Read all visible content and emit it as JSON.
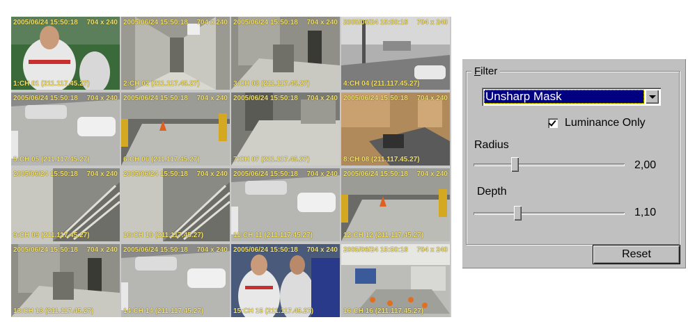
{
  "grid": {
    "tiles": [
      {
        "timestamp": "2005/06/24 15:50:18",
        "resolution": "704 x 240",
        "channel": "1:CH 01 (211.117.45.27)",
        "scene": "soccer-player"
      },
      {
        "timestamp": "2005/06/24 15:50:18",
        "resolution": "704 x 240",
        "channel": "2:CH 02 (211.117.45.27)",
        "scene": "corridor"
      },
      {
        "timestamp": "2005/06/24 15:50:18",
        "resolution": "704 x 240",
        "channel": "3:CH 03 (211.117.45.27)",
        "scene": "lobby"
      },
      {
        "timestamp": "2005/06/24 15:50:18",
        "resolution": "704 x 240",
        "channel": "4:CH 04 (211.117.45.27)",
        "scene": "street"
      },
      {
        "timestamp": "2005/06/24 15:50:18",
        "resolution": "704 x 240",
        "channel": "5:CH 05 (211.117.45.27)",
        "scene": "parking"
      },
      {
        "timestamp": "2005/06/24 15:50:18",
        "resolution": "704 x 240",
        "channel": "6:CH 06 (211.117.45.27)",
        "scene": "garage"
      },
      {
        "timestamp": "2005/06/24 15:50:18",
        "resolution": "704 x 240",
        "channel": "7:CH 07 (211.117.45.27)",
        "scene": "hall"
      },
      {
        "timestamp": "2005/06/24 15:50:18",
        "resolution": "704 x 240",
        "channel": "8:CH 08 (211.117.45.27)",
        "scene": "office"
      },
      {
        "timestamp": "2005/06/24 15:50:18",
        "resolution": "704 x 240",
        "channel": "9:CH 09 (211.117.45.27)",
        "scene": "stairs"
      },
      {
        "timestamp": "2005/06/24 15:50:18",
        "resolution": "704 x 240",
        "channel": "10:CH 10 (211.117.45.27)",
        "scene": "stairs"
      },
      {
        "timestamp": "2005/06/24 15:50:18",
        "resolution": "704 x 240",
        "channel": "11:CH 11 (211.117.45.27)",
        "scene": "parking"
      },
      {
        "timestamp": "2005/06/24 15:50:18",
        "resolution": "704 x 240",
        "channel": "12:CH 12 (211.117.45.27)",
        "scene": "garage"
      },
      {
        "timestamp": "2005/06/24 15:50:18",
        "resolution": "704 x 240",
        "channel": "13:CH 13 (211.117.45.27)",
        "scene": "lobby"
      },
      {
        "timestamp": "2005/06/24 15:50:18",
        "resolution": "704 x 240",
        "channel": "14:CH 14 (211.117.45.27)",
        "scene": "parking"
      },
      {
        "timestamp": "2005/06/24 15:50:18",
        "resolution": "704 x 240",
        "channel": "15:CH 15 (211.117.45.27)",
        "scene": "soccer-crowd"
      },
      {
        "timestamp": "2005/06/24 15:50:18",
        "resolution": "704 x 240",
        "channel": "16:CH 16 (211.117.45.27)",
        "scene": "meeting-room"
      }
    ],
    "selected_index": 0,
    "osd_color": "#f5e36a",
    "selection_color": "#3b3bff"
  },
  "filter": {
    "title_underlined": "F",
    "title_rest": "ilter",
    "selected_filter": "Unsharp Mask",
    "luminance_only_label": "Luminance Only",
    "luminance_only_checked": true,
    "radius": {
      "label": "Radius",
      "value": "2,00",
      "fraction": 0.27
    },
    "depth": {
      "label": "Depth",
      "value": "1,10",
      "fraction": 0.29
    },
    "reset_label": "Reset",
    "accent_color": "#000080"
  }
}
